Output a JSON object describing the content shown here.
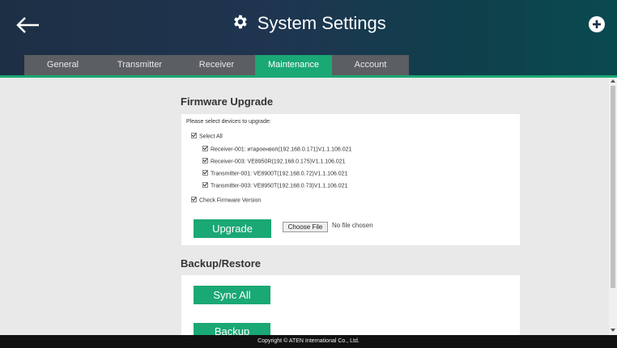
{
  "header": {
    "title": "System Settings",
    "back_icon": "arrow-left-icon",
    "settings_icon": "gear-icon",
    "add_icon": "plus-circle-icon"
  },
  "tabs": [
    {
      "label": "General",
      "active": false
    },
    {
      "label": "Transmitter",
      "active": false
    },
    {
      "label": "Receiver",
      "active": false
    },
    {
      "label": "Maintenance",
      "active": true
    },
    {
      "label": "Account",
      "active": false
    }
  ],
  "firmware": {
    "title": "Firmware Upgrade",
    "prompt": "Please select devices to upgrade:",
    "select_all": "Select All",
    "devices": [
      "Receiver-001: итароенвоп(192.168.0.171)V1.1.106.021",
      "Receiver-003: VE8950R(192.168.0.175)V1.1.106.021",
      "Transmitter-001: VE8900T(192.168.0.72)V1.1.106.021",
      "Transmitter-003: VE8950T(192.168.0.73)V1.1.106.021"
    ],
    "check_version": "Check Firmware Version",
    "upgrade_label": "Upgrade",
    "choose_file_label": "Choose File",
    "file_status": "No file chosen"
  },
  "backup": {
    "title": "Backup/Restore",
    "sync_label": "Sync All",
    "backup_label": "Backup"
  },
  "footer": {
    "copyright": "Copyright © ATEN International Co., Ltd."
  },
  "colors": {
    "accent": "#1aa874",
    "tab_inactive": "#5b5e62",
    "header_dark": "#1d2f45"
  }
}
